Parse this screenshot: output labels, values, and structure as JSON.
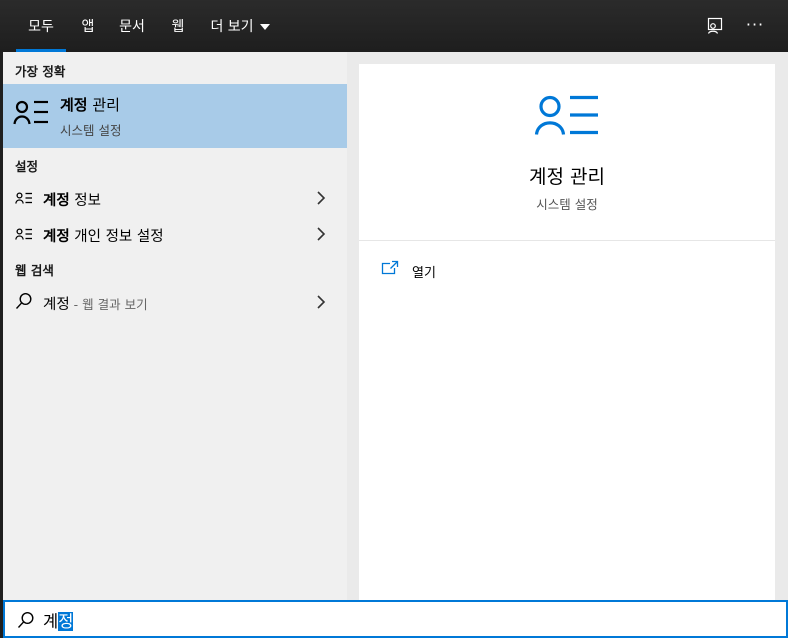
{
  "tabs": [
    {
      "label": "모두",
      "active": true
    },
    {
      "label": "앱"
    },
    {
      "label": "문서"
    },
    {
      "label": "웹"
    },
    {
      "label": "더 보기"
    }
  ],
  "top_icons": {
    "feedback": "feedback-icon",
    "more": "···"
  },
  "left": {
    "best_match_heading": "가장 정확",
    "best_match": {
      "icon": "account-icon",
      "title_bold": "계정",
      "title_rest": " 관리",
      "subtitle": "시스템 설정"
    },
    "settings_heading": "설정",
    "settings_items": [
      {
        "bold": "계정",
        "rest": " 정보"
      },
      {
        "bold": "계정",
        "rest": " 개인 정보 설정"
      }
    ],
    "web_heading": "웹 검색",
    "web_item": {
      "term": "계정",
      "suffix": " - 웹 결과 보기"
    }
  },
  "right": {
    "icon": "account-icon",
    "title": "계정 관리",
    "subtitle": "시스템 설정",
    "actions": [
      {
        "label": "열기",
        "icon": "open-window-icon"
      }
    ]
  },
  "search": {
    "value_plain": "계",
    "value_selected": "정"
  },
  "colors": {
    "accent": "#0078d7",
    "selected_row": "#a8cbe8",
    "left_bg": "#f0f0f0",
    "topbar_bg": "#1f1f1f"
  }
}
